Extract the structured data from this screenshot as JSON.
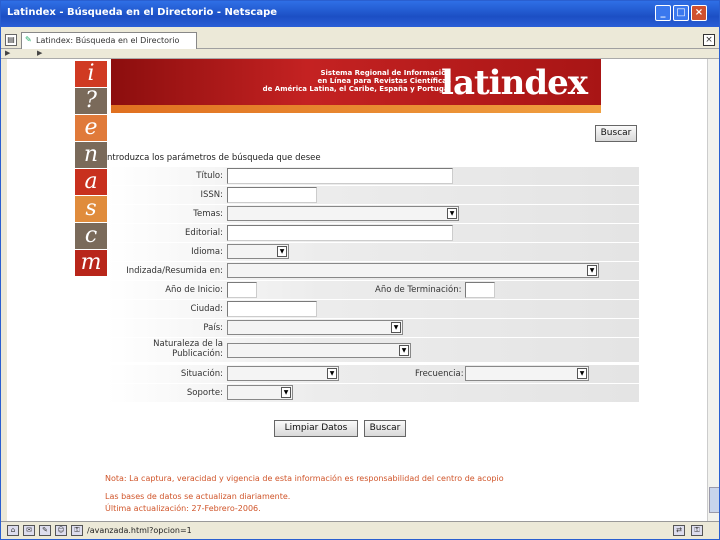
{
  "window": {
    "title": "Latindex - Búsqueda en el Directorio - Netscape",
    "tab_label": "Latindex: Búsqueda en el Directorio"
  },
  "sidebar_letters": [
    {
      "char": "i",
      "color": "#d03a22"
    },
    {
      "char": "?",
      "color": "#7a6a5a"
    },
    {
      "char": "e",
      "color": "#e07a3a"
    },
    {
      "char": "n",
      "color": "#7a6a5a"
    },
    {
      "char": "a",
      "color": "#c8301e"
    },
    {
      "char": "s",
      "color": "#e08c3c"
    },
    {
      "char": "c",
      "color": "#7a6a5a"
    },
    {
      "char": "m",
      "color": "#b8261a"
    }
  ],
  "banner": {
    "subtitle_lines": [
      "Sistema Regional de Información",
      "en Línea para Revistas Científicas",
      "de América Latina, el Caribe, España y Portugal"
    ],
    "logo": "latindex"
  },
  "form": {
    "search_button": "Buscar",
    "intro": "ntroduzca los parámetros de búsqueda que desee",
    "fields": {
      "titulo": "Título:",
      "issn": "ISSN:",
      "temas": "Temas:",
      "editorial": "Editorial:",
      "idioma": "Idioma:",
      "indizada": "Indizada/Resumida en:",
      "anio_inicio": "Año de Inicio:",
      "anio_terminacion": "Año de Terminación:",
      "ciudad": "Ciudad:",
      "pais": "País:",
      "naturaleza_line1": "Naturaleza de la",
      "naturaleza_line2": "Publicación:",
      "situacion": "Situación:",
      "frecuencia": "Frecuencia:",
      "soporte": "Soporte:"
    },
    "clear_button": "Limpiar Datos",
    "submit_button": "Buscar"
  },
  "notes": [
    "Nota: La captura, veracidad y vigencia de esta información es responsabilidad del centro de acopio",
    "Las bases de datos se actualizan diariamente.",
    "Última actualización: 27-Febrero-2006."
  ],
  "status": {
    "url": "/avanzada.html?opcion=1"
  }
}
